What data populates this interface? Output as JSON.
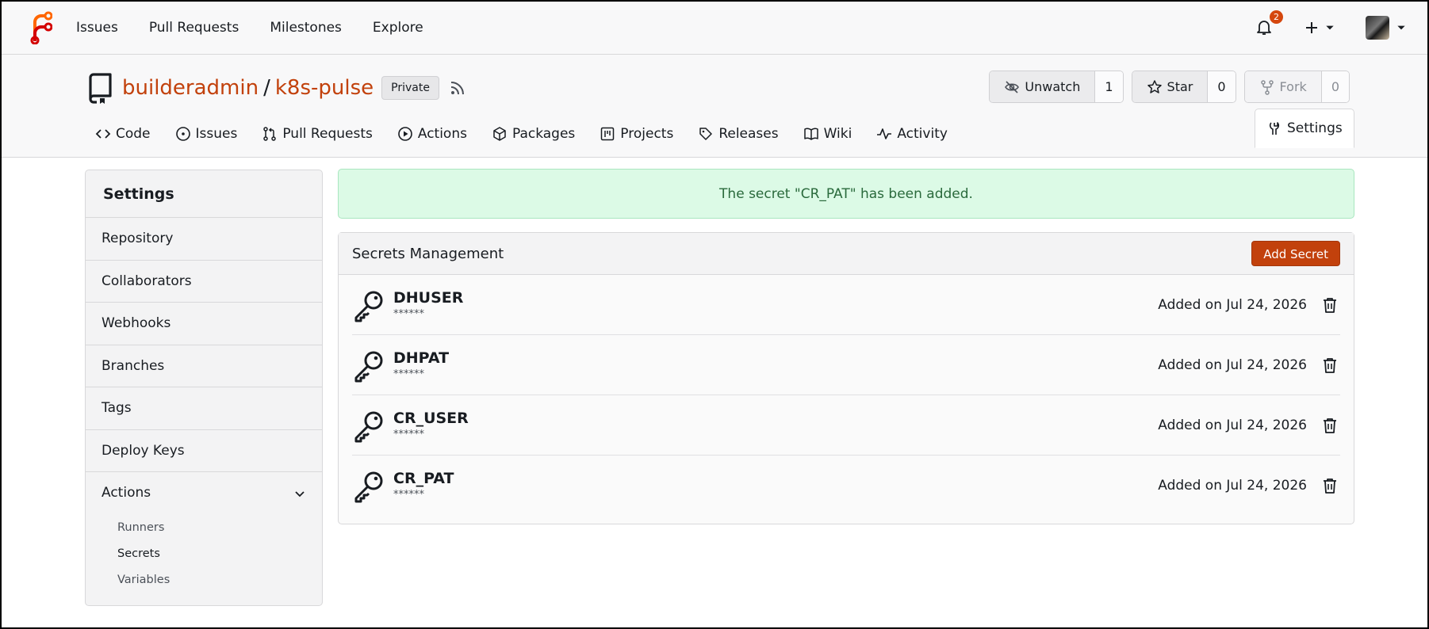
{
  "topnav": {
    "links": [
      "Issues",
      "Pull Requests",
      "Milestones",
      "Explore"
    ],
    "notification_count": "2"
  },
  "repo": {
    "owner": "builderadmin",
    "separator": "/",
    "name": "k8s-pulse",
    "visibility": "Private",
    "watch": {
      "label": "Unwatch",
      "count": "1"
    },
    "star": {
      "label": "Star",
      "count": "0"
    },
    "fork": {
      "label": "Fork",
      "count": "0"
    }
  },
  "tabs": [
    "Code",
    "Issues",
    "Pull Requests",
    "Actions",
    "Packages",
    "Projects",
    "Releases",
    "Wiki",
    "Activity"
  ],
  "active_tab": "Settings",
  "sidebar": {
    "title": "Settings",
    "items": [
      "Repository",
      "Collaborators",
      "Webhooks",
      "Branches",
      "Tags",
      "Deploy Keys"
    ],
    "actions_label": "Actions",
    "actions_sub": [
      "Runners",
      "Secrets",
      "Variables"
    ],
    "active_sub": "Secrets"
  },
  "flash": "The secret \"CR_PAT\" has been added.",
  "secrets_panel": {
    "title": "Secrets Management",
    "add_button": "Add Secret",
    "secrets": [
      {
        "name": "DHUSER",
        "mask": "******",
        "date": "Added on Jul 24, 2026"
      },
      {
        "name": "DHPAT",
        "mask": "******",
        "date": "Added on Jul 24, 2026"
      },
      {
        "name": "CR_USER",
        "mask": "******",
        "date": "Added on Jul 24, 2026"
      },
      {
        "name": "CR_PAT",
        "mask": "******",
        "date": "Added on Jul 24, 2026"
      }
    ]
  },
  "colors": {
    "accent": "#c2410c",
    "success_bg": "#dcfae6",
    "badge": "#d5470e"
  }
}
